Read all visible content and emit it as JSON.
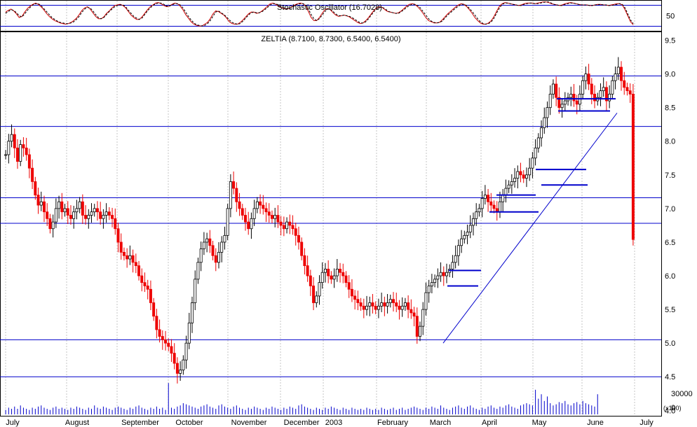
{
  "chart_data": [
    {
      "type": "line",
      "panel": "stochastic",
      "title": "Stochastic Oscillator (16.7028)",
      "y_ticks": [
        50
      ],
      "ylim": [
        0,
        100
      ],
      "reference_lines": [
        85,
        15
      ],
      "series": [
        {
          "name": "",
          "color": "#cc0000",
          "style": "solid",
          "values": [
            62,
            68,
            72,
            66,
            56,
            44,
            48,
            62,
            74,
            82,
            88,
            92,
            88,
            80,
            70,
            58,
            48,
            40,
            34,
            30,
            26,
            24,
            22,
            24,
            28,
            34,
            42,
            54,
            68,
            76,
            80,
            72,
            60,
            48,
            40,
            40,
            46,
            58,
            66,
            76,
            84,
            86,
            88,
            84,
            76,
            64,
            52,
            44,
            38,
            38,
            46,
            58,
            70,
            80,
            86,
            92,
            94,
            90,
            84,
            80,
            82,
            88,
            92,
            90,
            82,
            70,
            54,
            42,
            30,
            22,
            18,
            16,
            16,
            22,
            28,
            40,
            56,
            66,
            64,
            58,
            52,
            42,
            30,
            24,
            22,
            22,
            28,
            36,
            46,
            56,
            62,
            62,
            58,
            60,
            66,
            74,
            82,
            90,
            92,
            88,
            82,
            78,
            74,
            72,
            74,
            80,
            86,
            90,
            92,
            90,
            82,
            64,
            44,
            34,
            34,
            44,
            58,
            70,
            74,
            70,
            60,
            52,
            48,
            50,
            52,
            50,
            46,
            40,
            34,
            28,
            24,
            26,
            34,
            44,
            56,
            68,
            76,
            80,
            78,
            70,
            64,
            62,
            60,
            58,
            60,
            66,
            74,
            82,
            88,
            90,
            88,
            80,
            70,
            58,
            44,
            34,
            30,
            26,
            26,
            28,
            36,
            46,
            56,
            64,
            72,
            80,
            86,
            90,
            88,
            80,
            70,
            58,
            44,
            34,
            26,
            22,
            22,
            26,
            34,
            48,
            66,
            82,
            90,
            94,
            92,
            90,
            88,
            86,
            84,
            86,
            90,
            92,
            92,
            92,
            90,
            92,
            94,
            96,
            96,
            94,
            90,
            88,
            86,
            84,
            86,
            90,
            92,
            94,
            92,
            90,
            88,
            86,
            86,
            86,
            84,
            84,
            86,
            88,
            88,
            86,
            86,
            84,
            86,
            88,
            90,
            90,
            86,
            70,
            50,
            30,
            20
          ]
        },
        {
          "name": "",
          "color": "#000000",
          "style": "dashed",
          "values": [
            58,
            64,
            70,
            68,
            60,
            50,
            46,
            56,
            68,
            78,
            86,
            90,
            90,
            84,
            74,
            64,
            54,
            44,
            38,
            32,
            28,
            26,
            24,
            24,
            26,
            30,
            38,
            48,
            62,
            72,
            78,
            76,
            66,
            54,
            44,
            40,
            44,
            54,
            64,
            72,
            80,
            84,
            86,
            86,
            80,
            68,
            58,
            48,
            42,
            38,
            42,
            54,
            66,
            76,
            84,
            90,
            92,
            92,
            88,
            82,
            82,
            86,
            90,
            90,
            86,
            76,
            62,
            48,
            36,
            26,
            20,
            18,
            16,
            18,
            24,
            34,
            48,
            62,
            66,
            60,
            54,
            46,
            36,
            28,
            24,
            22,
            24,
            32,
            42,
            52,
            60,
            62,
            60,
            60,
            64,
            70,
            78,
            86,
            90,
            90,
            86,
            80,
            76,
            74,
            74,
            78,
            84,
            88,
            90,
            90,
            86,
            72,
            54,
            40,
            34,
            40,
            52,
            64,
            72,
            72,
            64,
            56,
            50,
            50,
            52,
            50,
            48,
            44,
            38,
            32,
            26,
            26,
            30,
            40,
            52,
            64,
            72,
            78,
            78,
            74,
            66,
            62,
            60,
            58,
            58,
            64,
            70,
            78,
            84,
            88,
            88,
            84,
            76,
            64,
            52,
            40,
            32,
            28,
            26,
            28,
            32,
            42,
            52,
            60,
            68,
            76,
            82,
            88,
            88,
            84,
            74,
            64,
            52,
            40,
            30,
            24,
            22,
            24,
            30,
            42,
            60,
            76,
            88,
            92,
            92,
            90,
            88,
            86,
            84,
            84,
            88,
            90,
            92,
            92,
            90,
            90,
            92,
            94,
            96,
            96,
            92,
            88,
            86,
            84,
            84,
            88,
            90,
            92,
            92,
            90,
            88,
            86,
            86,
            86,
            84,
            84,
            86,
            86,
            88,
            86,
            86,
            84,
            84,
            86,
            88,
            90,
            88,
            76,
            56,
            36,
            24
          ]
        }
      ]
    },
    {
      "type": "candlestick",
      "panel": "price",
      "title": "ZELTIA (8.7100, 8.7300, 6.5400, 6.5400)",
      "y_ticks": [
        4.0,
        4.5,
        5.0,
        5.5,
        6.0,
        6.5,
        7.0,
        7.5,
        8.0,
        8.5,
        9.0,
        9.5
      ],
      "ylim": [
        3.92,
        9.62
      ],
      "x_labels": [
        "July",
        "August",
        "September",
        "October",
        "November",
        "December",
        "2003",
        "February",
        "March",
        "April",
        "May",
        "June",
        "July"
      ],
      "horizontal_lines": [
        4.5,
        5.05,
        6.78,
        7.16,
        8.22,
        8.97
      ],
      "trendline": {
        "from": [
          5.0
        ],
        "to": [
          8.42
        ]
      },
      "short_segments": [
        {
          "y": 5.85
        },
        {
          "y": 6.08
        },
        {
          "y": 6.95
        },
        {
          "y": 7.2
        },
        {
          "y": 7.35
        },
        {
          "y": 7.58
        },
        {
          "y": 8.45
        },
        {
          "y": 8.63
        }
      ],
      "close": [
        7.8,
        8.0,
        8.1,
        7.9,
        7.7,
        7.95,
        7.9,
        7.8,
        7.6,
        7.4,
        7.2,
        7.05,
        7.1,
        6.95,
        6.85,
        6.7,
        6.8,
        7.0,
        7.1,
        6.95,
        7.0,
        6.9,
        6.85,
        6.95,
        7.0,
        7.1,
        6.9,
        6.85,
        6.9,
        6.95,
        7.0,
        6.95,
        6.85,
        6.9,
        6.95,
        6.9,
        6.85,
        6.7,
        6.5,
        6.35,
        6.3,
        6.25,
        6.3,
        6.2,
        6.15,
        6.0,
        5.9,
        5.85,
        5.8,
        5.6,
        5.4,
        5.2,
        5.1,
        5.05,
        5.0,
        4.95,
        4.85,
        4.7,
        4.55,
        4.6,
        4.75,
        5.0,
        5.3,
        5.6,
        5.95,
        6.2,
        6.4,
        6.5,
        6.55,
        6.45,
        6.3,
        6.2,
        6.35,
        6.5,
        6.6,
        7.0,
        7.4,
        7.3,
        7.1,
        7.0,
        6.9,
        6.8,
        6.7,
        6.85,
        7.0,
        7.1,
        7.05,
        7.0,
        6.95,
        6.9,
        6.85,
        6.9,
        6.8,
        6.75,
        6.7,
        6.8,
        6.75,
        6.7,
        6.6,
        6.5,
        6.3,
        6.15,
        6.0,
        5.85,
        5.6,
        5.7,
        5.9,
        6.05,
        6.1,
        6.0,
        5.95,
        6.0,
        6.1,
        6.05,
        6.0,
        5.9,
        5.8,
        5.7,
        5.65,
        5.6,
        5.55,
        5.5,
        5.55,
        5.6,
        5.55,
        5.5,
        5.55,
        5.6,
        5.55,
        5.6,
        5.65,
        5.6,
        5.55,
        5.5,
        5.55,
        5.6,
        5.5,
        5.45,
        5.4,
        5.1,
        5.25,
        5.5,
        5.75,
        5.85,
        5.9,
        5.95,
        6.0,
        6.05,
        6.0,
        6.05,
        6.1,
        6.2,
        6.3,
        6.45,
        6.55,
        6.6,
        6.65,
        6.75,
        6.85,
        6.95,
        7.0,
        7.15,
        7.2,
        7.1,
        7.05,
        7.0,
        6.95,
        7.1,
        7.2,
        7.3,
        7.35,
        7.4,
        7.45,
        7.55,
        7.5,
        7.45,
        7.5,
        7.6,
        7.75,
        7.9,
        8.05,
        8.2,
        8.35,
        8.5,
        8.7,
        8.85,
        8.65,
        8.5,
        8.55,
        8.6,
        8.65,
        8.7,
        8.6,
        8.55,
        8.7,
        8.9,
        9.0,
        8.85,
        8.7,
        8.6,
        8.65,
        8.75,
        8.8,
        8.6,
        8.7,
        8.9,
        9.0,
        9.1,
        8.9,
        8.8,
        8.75,
        8.7,
        6.54
      ],
      "volume_label": "(x100)",
      "volume_ticks": [
        30000,
        0
      ],
      "volume": [
        4,
        6,
        5,
        7,
        5,
        8,
        6,
        5,
        4,
        6,
        5,
        7,
        8,
        6,
        5,
        4,
        6,
        7,
        5,
        6,
        5,
        4,
        6,
        5,
        7,
        6,
        5,
        4,
        6,
        5,
        8,
        6,
        5,
        7,
        6,
        5,
        4,
        6,
        7,
        6,
        5,
        4,
        6,
        5,
        7,
        8,
        6,
        5,
        4,
        6,
        5,
        7,
        5,
        6,
        4,
        28,
        6,
        5,
        7,
        8,
        10,
        9,
        8,
        7,
        6,
        5,
        7,
        8,
        9,
        7,
        6,
        5,
        8,
        9,
        7,
        6,
        5,
        7,
        8,
        6,
        5,
        4,
        6,
        5,
        7,
        6,
        5,
        4,
        6,
        5,
        7,
        6,
        5,
        4,
        6,
        5,
        7,
        6,
        5,
        8,
        9,
        7,
        6,
        5,
        4,
        6,
        5,
        4,
        6,
        5,
        7,
        6,
        5,
        4,
        6,
        5,
        4,
        6,
        5,
        4,
        5,
        4,
        6,
        5,
        4,
        5,
        4,
        6,
        5,
        4,
        5,
        6,
        4,
        5,
        6,
        4,
        5,
        6,
        7,
        6,
        5,
        4,
        6,
        5,
        7,
        6,
        5,
        8,
        6,
        5,
        4,
        6,
        7,
        8,
        6,
        5,
        7,
        8,
        6,
        5,
        4,
        6,
        5,
        7,
        8,
        6,
        5,
        7,
        6,
        8,
        9,
        7,
        6,
        5,
        8,
        9,
        10,
        9,
        8,
        22,
        14,
        18,
        12,
        16,
        10,
        8,
        9,
        11,
        10,
        12,
        9,
        8,
        10,
        11,
        9,
        12,
        10,
        9,
        8,
        7,
        18
      ]
    }
  ]
}
